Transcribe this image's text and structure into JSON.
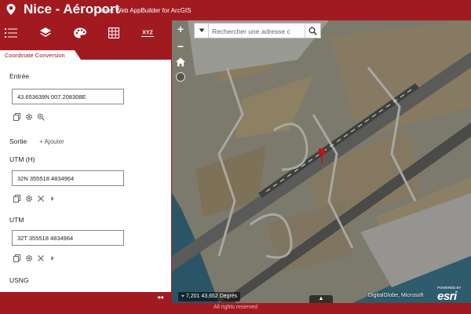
{
  "app": {
    "title": "Nice - Aéroport",
    "subtitle": "avec Web AppBuilder for ArcGIS",
    "footer_text": "All rights reserved"
  },
  "toolbar": {
    "items": [
      {
        "name": "legend",
        "icon": "list-icon"
      },
      {
        "name": "layers",
        "icon": "layers-icon"
      },
      {
        "name": "basemap",
        "icon": "palette-icon"
      },
      {
        "name": "grid",
        "icon": "grid-icon"
      },
      {
        "name": "coordinate",
        "icon": "xyz-icon",
        "label": "XYZ"
      }
    ]
  },
  "panel": {
    "tab_label": "Coordinate Conversion",
    "input_label": "Entrée",
    "input_value": "43.653639N 007.208308E",
    "output_label": "Sortie",
    "add_label": "Ajouter",
    "outputs": [
      {
        "label": "UTM (H)",
        "value": "32N 355518 4834964"
      },
      {
        "label": "UTM",
        "value": "32T 355518 4834964"
      },
      {
        "label": "USNG",
        "value": ""
      }
    ],
    "collapse_glyph": "◂◂"
  },
  "map": {
    "search_placeholder": "Rechercher une adresse c",
    "zoom_in": "+",
    "zoom_out": "−",
    "coords": "7,201 43,652 Degrés",
    "attribution": "DigitalGlobe, Microsoft",
    "esri_powered": "POWERED BY",
    "esri_name": "esri",
    "expand_glyph": "▲"
  },
  "colors": {
    "brand": "#a11a20",
    "panel_bg": "#ffffff"
  }
}
